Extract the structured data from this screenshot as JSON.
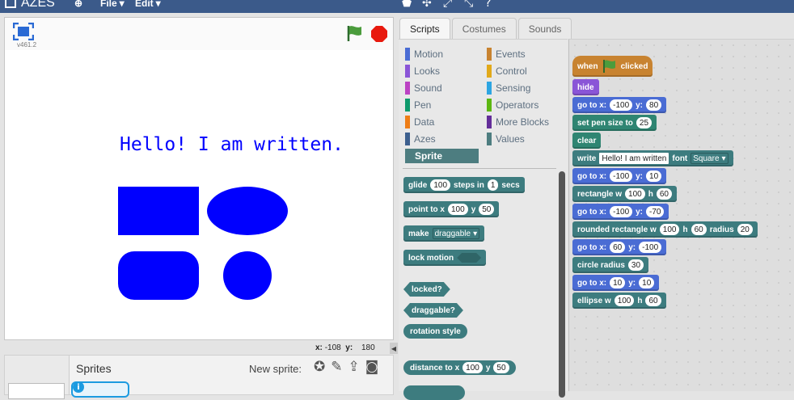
{
  "topbar": {
    "app_title": "AZES",
    "menu_file": "File",
    "menu_edit": "Edit"
  },
  "stage": {
    "version": "v461.2",
    "text": "Hello! I am written.",
    "text_color": "#0000ff",
    "shape_color": "#0000ff"
  },
  "readout": {
    "x_label": "x:",
    "x": "-108",
    "y_label": "y:",
    "y": "180"
  },
  "sprites": {
    "title": "Sprites",
    "new_sprite": "New sprite:"
  },
  "tabs": {
    "scripts": "Scripts",
    "costumes": "Costumes",
    "sounds": "Sounds"
  },
  "categories": {
    "left": [
      "Motion",
      "Looks",
      "Sound",
      "Pen",
      "Data",
      "Azes"
    ],
    "right": [
      "Events",
      "Control",
      "Sensing",
      "Operators",
      "More Blocks",
      "Values"
    ],
    "left_colors": [
      "#4a6cd4",
      "#8a55d7",
      "#bb42c3",
      "#0e9a6c",
      "#ee7d16",
      "#3d5f8e"
    ],
    "right_colors": [
      "#c88330",
      "#e1a91a",
      "#2ca5e2",
      "#5cb712",
      "#632d99",
      "#4d7d80"
    ],
    "selected": "Sprite"
  },
  "palette": {
    "glide": {
      "a": "glide",
      "v1": "100",
      "b": "steps in",
      "v2": "1",
      "c": "secs"
    },
    "point": {
      "a": "point to x",
      "v1": "100",
      "b": "y",
      "v2": "50"
    },
    "make": {
      "a": "make",
      "v1": "draggable"
    },
    "lock": {
      "a": "lock motion"
    },
    "locked": "locked?",
    "draggable": "draggable?",
    "rotation": "rotation style",
    "distance": {
      "a": "distance to x",
      "v1": "100",
      "b": "y",
      "v2": "50"
    }
  },
  "script": {
    "hat": {
      "a": "when",
      "b": "clicked"
    },
    "hide": "hide",
    "goto1": {
      "a": "go to x:",
      "x": "-100",
      "b": "y:",
      "y": "80"
    },
    "pensize": {
      "a": "set pen size to",
      "v": "25"
    },
    "clear": "clear",
    "write": {
      "a": "write",
      "v": "Hello! I am written",
      "b": "font",
      "font": "Square"
    },
    "goto2": {
      "a": "go to x:",
      "x": "-100",
      "b": "y:",
      "y": "10"
    },
    "rect": {
      "a": "rectangle w",
      "w": "100",
      "b": "h",
      "h": "60"
    },
    "goto3": {
      "a": "go to x:",
      "x": "-100",
      "b": "y:",
      "y": "-70"
    },
    "rrect": {
      "a": "rounded rectangle w",
      "w": "100",
      "b": "h",
      "h": "60",
      "c": "radius",
      "r": "20"
    },
    "goto4": {
      "a": "go to x:",
      "x": "60",
      "b": "y:",
      "y": "-100"
    },
    "circle": {
      "a": "circle radius",
      "r": "30"
    },
    "goto5": {
      "a": "go to x:",
      "x": "10",
      "b": "y:",
      "y": "10"
    },
    "ellipse": {
      "a": "ellipse w",
      "w": "100",
      "b": "h",
      "h": "60"
    }
  }
}
